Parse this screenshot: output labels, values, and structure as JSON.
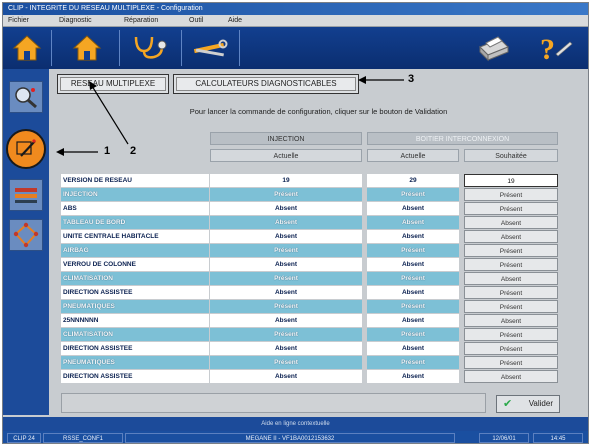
{
  "window": {
    "title": "CLIP - INTEGRITE DU RESEAU MULTIPLEXE - Configuration"
  },
  "menu": [
    "Fichier",
    "Diagnostic",
    "Réparation",
    "Outil",
    "Aide"
  ],
  "tabs": [
    {
      "label": "RESEAU MULTIPLEXE"
    },
    {
      "label": "CALCULATEURS DIAGNOSTICABLES"
    }
  ],
  "callouts": [
    "1",
    "2",
    "3"
  ],
  "instruction": "Pour lancer la commande de configuration, cliquer sur le bouton de Validation",
  "columns": {
    "injection": "INJECTION",
    "injection_sub": "Actuelle",
    "bsi": "BOITIER INTERCONNEXION",
    "bsi_sub_actuelle": "Actuelle",
    "bsi_sub_souhaitee": "Souhaitée"
  },
  "rows": [
    {
      "label": "VERSION DE RESEAU",
      "injection": "19",
      "bsi_actuelle": "29",
      "bsi_souhaitee": "19"
    },
    {
      "label": "INJECTION",
      "injection": "Présent",
      "bsi_actuelle": "Présent",
      "bsi_souhaitee": "Présent"
    },
    {
      "label": "ABS",
      "injection": "Absent",
      "bsi_actuelle": "Absent",
      "bsi_souhaitee": "Présent"
    },
    {
      "label": "TABLEAU DE BORD",
      "injection": "Absent",
      "bsi_actuelle": "Absent",
      "bsi_souhaitee": "Absent"
    },
    {
      "label": "UNITE CENTRALE HABITACLE",
      "injection": "Absent",
      "bsi_actuelle": "Absent",
      "bsi_souhaitee": "Absent"
    },
    {
      "label": "AIRBAG",
      "injection": "Présent",
      "bsi_actuelle": "Présent",
      "bsi_souhaitee": "Présent"
    },
    {
      "label": "VERROU DE COLONNE",
      "injection": "Absent",
      "bsi_actuelle": "Absent",
      "bsi_souhaitee": "Présent"
    },
    {
      "label": "CLIMATISATION",
      "injection": "Présent",
      "bsi_actuelle": "Présent",
      "bsi_souhaitee": "Absent"
    },
    {
      "label": "DIRECTION ASSISTEE",
      "injection": "Absent",
      "bsi_actuelle": "Absent",
      "bsi_souhaitee": "Présent"
    },
    {
      "label": "PNEUMATIQUES",
      "injection": "Présent",
      "bsi_actuelle": "Présent",
      "bsi_souhaitee": "Présent"
    },
    {
      "label": "25NNNNNN",
      "injection": "Absent",
      "bsi_actuelle": "Absent",
      "bsi_souhaitee": "Absent"
    },
    {
      "label": "CLIMATISATION",
      "injection": "Présent",
      "bsi_actuelle": "Présent",
      "bsi_souhaitee": "Présent"
    },
    {
      "label": "DIRECTION ASSISTEE",
      "injection": "Absent",
      "bsi_actuelle": "Absent",
      "bsi_souhaitee": "Présent"
    },
    {
      "label": "PNEUMATIQUES",
      "injection": "Présent",
      "bsi_actuelle": "Présent",
      "bsi_souhaitee": "Présent"
    },
    {
      "label": "DIRECTION ASSISTEE",
      "injection": "Absent",
      "bsi_actuelle": "Absent",
      "bsi_souhaitee": "Absent"
    }
  ],
  "buttons": {
    "valider": "Valider"
  },
  "help_text": "Aide en ligne contextuelle",
  "statusbar": {
    "left1": "CLIP 24",
    "left2": "RSSE_CONF1",
    "middle": "MEGANE II - VF1BA0012153632",
    "date": "12/06/01",
    "time": "14:45"
  },
  "colors": {
    "accent_orange": "#f08a1e",
    "toolbar_blue": "#123f8f",
    "row_teal": "#7dc0d6"
  },
  "icons": [
    "home-icon",
    "home-icon",
    "stethoscope-icon",
    "tools-icon",
    "printer-icon",
    "help-icon",
    "zoom-icon",
    "pen-icon",
    "wiring-icon",
    "network-icon",
    "check-icon"
  ]
}
